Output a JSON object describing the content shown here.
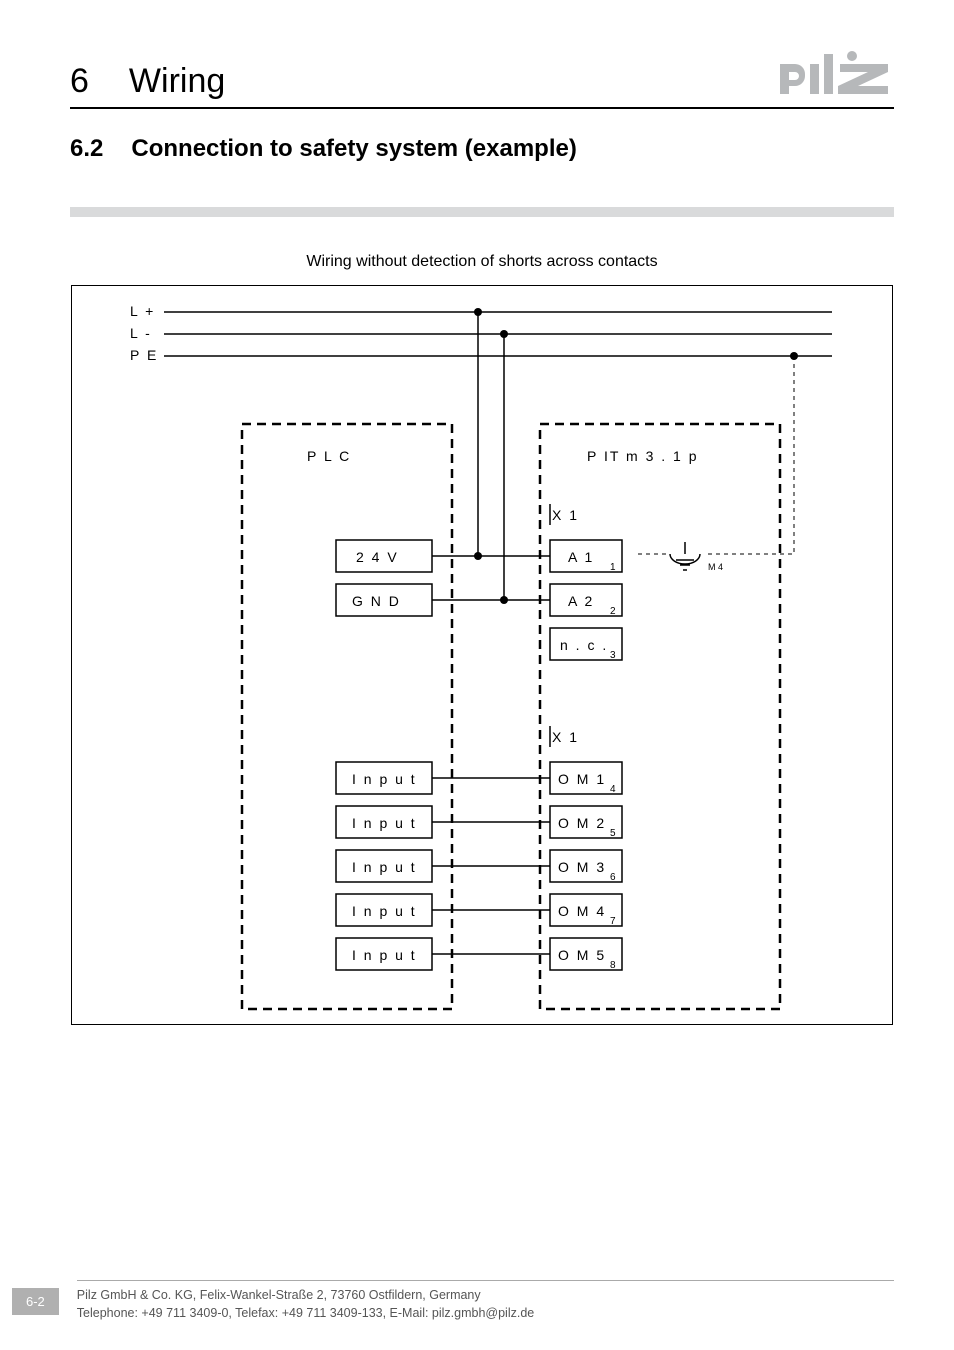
{
  "header": {
    "chapter_number": "6",
    "chapter_title": "Wiring",
    "logo_text": "pilz"
  },
  "section": {
    "number": "6.2",
    "title": "Connection to safety system (example)"
  },
  "caption": "Wiring without detection of shorts across contacts",
  "diagram": {
    "rails": {
      "lplus": "L +",
      "lminus": "L -",
      "pe": "P E"
    },
    "plc": {
      "title": "P L C",
      "power": {
        "v24": "2 4 V",
        "gnd": "G N D"
      },
      "inputs": [
        "I n p u t",
        "I n p u t",
        "I n p u t",
        "I n p u t",
        "I n p u t"
      ]
    },
    "pit": {
      "title": "P IT  m 3 . 1 p",
      "x1a": {
        "label": "X 1",
        "pins": [
          {
            "name": "A 1",
            "num": "1"
          },
          {
            "name": "A 2",
            "num": "2"
          },
          {
            "name": "n . c .",
            "num": "3"
          }
        ]
      },
      "earth_label": "M 4",
      "x1b": {
        "label": "X 1",
        "pins": [
          {
            "name": "O M 1",
            "num": "4"
          },
          {
            "name": "O M 2",
            "num": "5"
          },
          {
            "name": "O M 3",
            "num": "6"
          },
          {
            "name": "O M 4",
            "num": "7"
          },
          {
            "name": "O M 5",
            "num": "8"
          }
        ]
      }
    }
  },
  "footer": {
    "page": "6-2",
    "line1": "Pilz GmbH & Co. KG, Felix-Wankel-Straße 2, 73760 Ostfildern, Germany",
    "line2": "Telephone: +49 711 3409-0, Telefax: +49 711 3409-133, E-Mail: pilz.gmbh@pilz.de"
  }
}
